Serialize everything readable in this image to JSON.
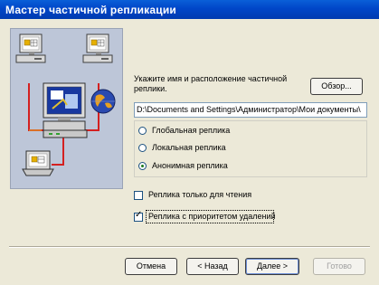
{
  "window": {
    "title": "Мастер частичной репликации"
  },
  "instructions": "Укажите имя и расположение частичной реплики.",
  "browse_button": "Обзор...",
  "path_value": "D:\\Documents and Settings\\Администратор\\Мои документы\\",
  "replica_type": {
    "options": [
      "Глобальная реплика",
      "Локальная реплика",
      "Анонимная реплика"
    ],
    "selected": "Анонимная реплика"
  },
  "readonly_checkbox": {
    "label": "Реплика только для чтения",
    "checked": false
  },
  "priority_checkbox": {
    "label": "Реплика с приоритетом удалений",
    "checked": true
  },
  "buttons": {
    "cancel": "Отмена",
    "back": "< Назад",
    "next": "Далее >",
    "finish": "Готово"
  },
  "colors": {
    "title_bar": "#0046c8",
    "dialog_bg": "#ece9d8",
    "illustration_bg": "#bdc6d8"
  },
  "icons": [
    "computer-icon",
    "database-icon",
    "globe-icon",
    "laptop-icon",
    "network-hub-icon"
  ]
}
